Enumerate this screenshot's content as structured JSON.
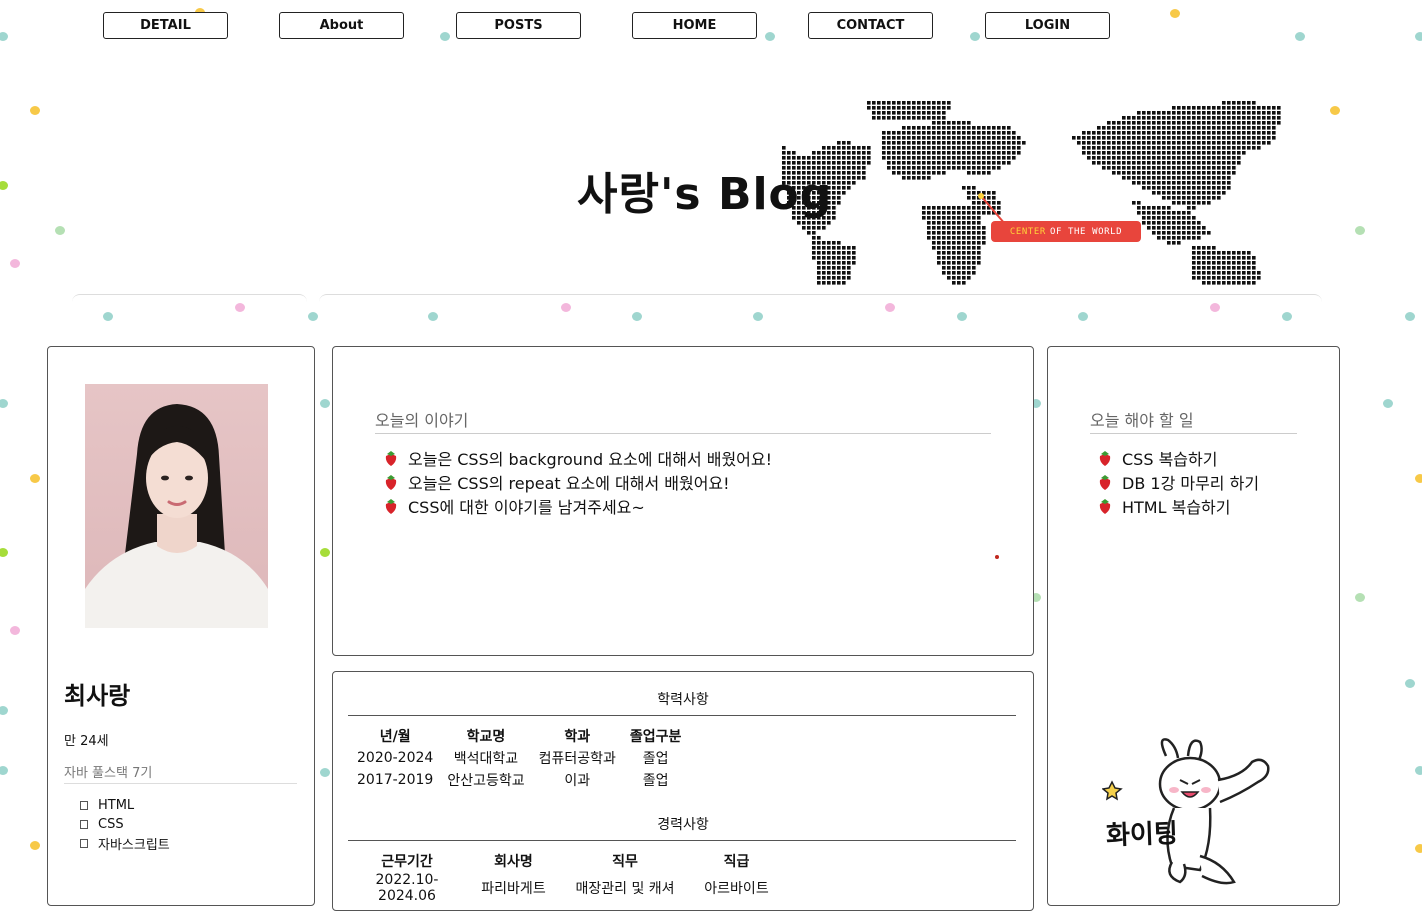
{
  "nav": {
    "items": [
      {
        "label": "DETAIL"
      },
      {
        "label": "About"
      },
      {
        "label": "POSTS"
      },
      {
        "label": "HOME"
      },
      {
        "label": "CONTACT"
      },
      {
        "label": "LOGIN"
      }
    ]
  },
  "header": {
    "blog_title": "사랑's Blog",
    "map_tag_highlight": "CENTER",
    "map_tag_rest": "OF THE WORLD"
  },
  "profile": {
    "name": "최사랑",
    "age": "만 24세",
    "course": "자바 풀스택 7기",
    "skills": [
      "HTML",
      "CSS",
      "자바스크립트"
    ]
  },
  "story": {
    "title": "오늘의 이야기",
    "items": [
      "오늘은 CSS의 background 요소에 대해서 배웠어요!",
      "오늘은 CSS의 repeat 요소에 대해서 배웠어요!",
      "CSS에 대한 이야기를 남겨주세요~"
    ]
  },
  "todo": {
    "title": "오늘 해야 할 일",
    "items": [
      "CSS 복습하기",
      "DB 1강 마무리 하기",
      "HTML 복습하기"
    ]
  },
  "education": {
    "title": "학력사항",
    "headers": [
      "년/월",
      "학교명",
      "학과",
      "졸업구분"
    ],
    "rows": [
      [
        "2020-2024",
        "백석대학교",
        "컴퓨터공학과",
        "졸업"
      ],
      [
        "2017-2019",
        "안산고등학교",
        "이과",
        "졸업"
      ]
    ]
  },
  "career": {
    "title": "경력사항",
    "headers": [
      "근무기간",
      "회사명",
      "직무",
      "직급"
    ],
    "rows": [
      [
        "2022.10-2024.06",
        "파리바게트",
        "매장관리 및 캐셔",
        "아르바이트"
      ]
    ]
  },
  "sticker": {
    "text": "화이팅"
  },
  "colors": {
    "dot_teal": "#9fd6cf",
    "dot_yellow": "#f7c948",
    "dot_green": "#a6dd3a",
    "dot_pink": "#f3b7dc",
    "dot_mint": "#b5e0b4",
    "tag_red": "#e8453c",
    "strawberry": "#d8232a"
  }
}
